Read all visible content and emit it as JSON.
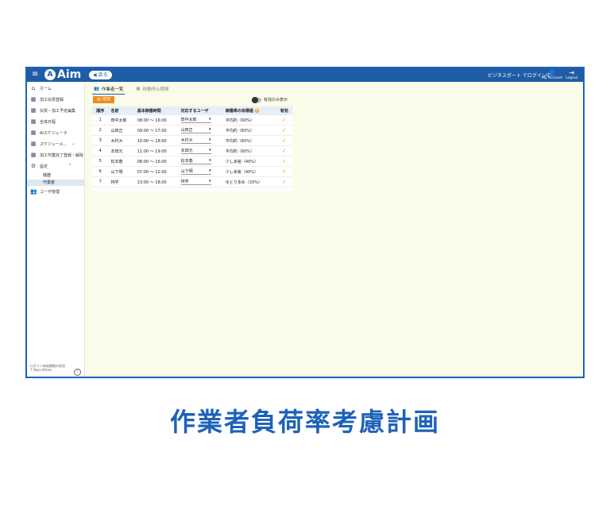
{
  "topbar": {
    "menu_icon": "hamburger-icon",
    "logo_text": "Aim",
    "back_label": "戻る",
    "company": "ビジネスポート でログイン中",
    "account_label": "My Account",
    "logout_label": "Logout"
  },
  "sidebar": {
    "items": [
      {
        "icon": "home-icon",
        "label": "ホーム"
      },
      {
        "icon": "calendar-icon",
        "label": "加工伝票登録"
      },
      {
        "icon": "calendar-icon",
        "label": "伝票・加工予定編集"
      },
      {
        "icon": "calendar-icon",
        "label": "全体日程"
      },
      {
        "icon": "calendar-icon",
        "label": "AIスケジューラ"
      },
      {
        "icon": "calendar-icon",
        "label": "スケジュール..."
      },
      {
        "icon": "calendar-icon",
        "label": "加工作業完了登録・解除"
      },
      {
        "icon": "gear-icon",
        "label": "設定"
      }
    ],
    "sub_items": [
      "機器",
      "作業者"
    ],
    "user_mgmt": "ユーザ管理",
    "footer_line1": "ログイン有効期限の状況",
    "footer_line2": "7 Days 8mins"
  },
  "tabs": [
    {
      "label": "作業者一覧",
      "active": true
    },
    {
      "label": "稼働停止期間",
      "active": false
    }
  ],
  "add_button": "追加",
  "toggle_label": "有効のみ表示",
  "table": {
    "headers": [
      "順序",
      "名前",
      "基本稼働時間",
      "対応するユーザ",
      "稼働率の目標値",
      "有効"
    ],
    "rows": [
      {
        "order": "1",
        "name": "田中太郎",
        "hours": "08:00 ～ 16:00",
        "user": "田中太郎",
        "target": "平均的（60%）"
      },
      {
        "order": "2",
        "name": "山田正",
        "hours": "09:00 ～ 17:00",
        "user": "山田正",
        "target": "平均的（60%）"
      },
      {
        "order": "3",
        "name": "木村大",
        "hours": "10:00 ～ 18:00",
        "user": "木村大",
        "target": "平均的（60%）"
      },
      {
        "order": "4",
        "name": "本田元",
        "hours": "11:00 ～ 19:00",
        "user": "本田元",
        "target": "平均的（60%）"
      },
      {
        "order": "5",
        "name": "松本春",
        "hours": "08:00 ～ 16:00",
        "user": "松本春",
        "target": "少し余裕（40%）"
      },
      {
        "order": "6",
        "name": "山下明",
        "hours": "07:00 ～ 12:00",
        "user": "山下明",
        "target": "少し余裕（40%）"
      },
      {
        "order": "7",
        "name": "林学",
        "hours": "13:00 ～ 18:00",
        "user": "林学",
        "target": "ゆとり多め（20%）"
      }
    ]
  },
  "caption": "作業者負荷率考慮計画",
  "colors": {
    "accent": "#1f5ca6",
    "orange": "#f08a1e",
    "bg": "#fbfbea"
  }
}
